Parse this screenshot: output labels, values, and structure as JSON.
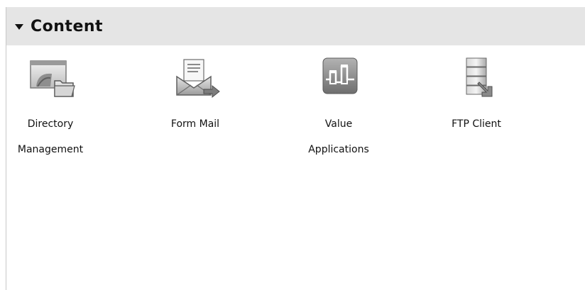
{
  "section": {
    "title": "Content"
  },
  "items": [
    {
      "label_line1": "Directory",
      "label_line2": "Management",
      "icon": "directory-management-icon"
    },
    {
      "label_line1": "Form Mail",
      "label_line2": "",
      "icon": "form-mail-icon"
    },
    {
      "label_line1": "Value",
      "label_line2": "Applications",
      "icon": "value-applications-icon"
    },
    {
      "label_line1": "FTP Client",
      "label_line2": "",
      "icon": "ftp-client-icon"
    }
  ]
}
